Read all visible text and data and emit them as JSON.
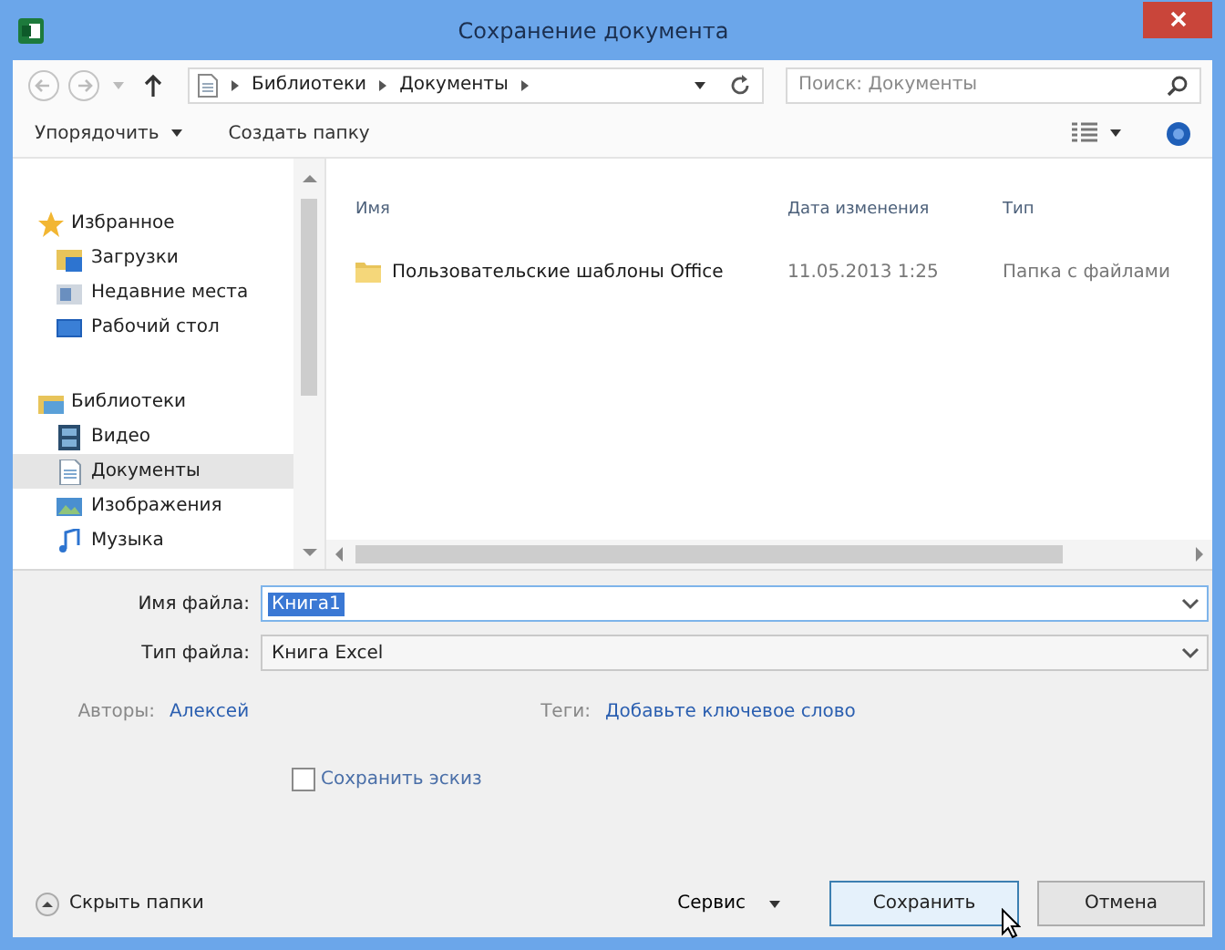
{
  "window": {
    "title": "Сохранение документа"
  },
  "nav_buttons": [
    {
      "kind": "back",
      "disabled": true
    },
    {
      "kind": "forward",
      "disabled": true
    },
    {
      "kind": "up",
      "disabled": false
    }
  ],
  "address": {
    "segments": [
      "Библиотеки",
      "Документы"
    ]
  },
  "search": {
    "placeholder": "Поиск: Документы"
  },
  "toolbar": {
    "organize": "Упорядочить",
    "new_folder": "Создать папку"
  },
  "sidebar": {
    "groups": [
      {
        "label": "Избранное",
        "kind": "star",
        "children": [
          {
            "label": "Загрузки",
            "kind": "download",
            "selected": false
          },
          {
            "label": "Недавние места",
            "kind": "recent",
            "selected": false
          },
          {
            "label": "Рабочий стол",
            "kind": "desktop",
            "selected": false
          }
        ]
      },
      {
        "label": "Библиотеки",
        "kind": "library",
        "children": [
          {
            "label": "Видео",
            "kind": "video",
            "selected": false
          },
          {
            "label": "Документы",
            "kind": "documents",
            "selected": true
          },
          {
            "label": "Изображения",
            "kind": "pictures",
            "selected": false
          },
          {
            "label": "Музыка",
            "kind": "music",
            "selected": false
          }
        ]
      }
    ]
  },
  "table": {
    "columns": [
      "Имя",
      "Дата изменения",
      "Тип"
    ],
    "rows": [
      {
        "name": "Пользовательские шаблоны Office",
        "date": "11.05.2013 1:25",
        "type": "Папка с файлами"
      }
    ]
  },
  "form": {
    "file_name": {
      "label": "Имя файла:",
      "value": "Книга1",
      "value_selected": true
    },
    "file_type": {
      "label": "Тип файла:",
      "value": "Книга Excel"
    },
    "authors": {
      "label": "Авторы:",
      "value": "Алексей"
    },
    "tags": {
      "label": "Теги:",
      "value": "Добавьте ключевое слово"
    },
    "thumbnail": {
      "label": "Сохранить эскиз",
      "checked": false
    }
  },
  "footer": {
    "hide_folders": "Скрыть папки",
    "service": "Сервис",
    "buttons": [
      {
        "label": "Сохранить",
        "kind": "default"
      },
      {
        "label": "Отмена",
        "kind": "normal"
      }
    ]
  }
}
